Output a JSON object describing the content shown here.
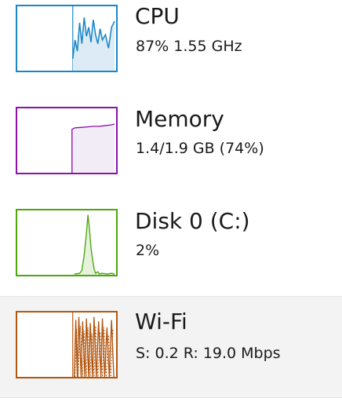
{
  "colors": {
    "cpu": "#1a86c7",
    "memory": "#8b12ae",
    "disk": "#4da60c",
    "wifi": "#b2560f",
    "selected_bg": "#f3f3f3"
  },
  "items": [
    {
      "id": "cpu",
      "label": "CPU",
      "detail": "87%  1.55 GHz",
      "selected": false
    },
    {
      "id": "memory",
      "label": "Memory",
      "detail": "1.4/1.9 GB (74%)",
      "selected": false
    },
    {
      "id": "disk",
      "label": "Disk 0 (C:)",
      "detail": "2%",
      "selected": false
    },
    {
      "id": "wifi",
      "label": "Wi-Fi",
      "detail": "S: 0.2  R: 19.0 Mbps",
      "selected": true
    }
  ]
}
